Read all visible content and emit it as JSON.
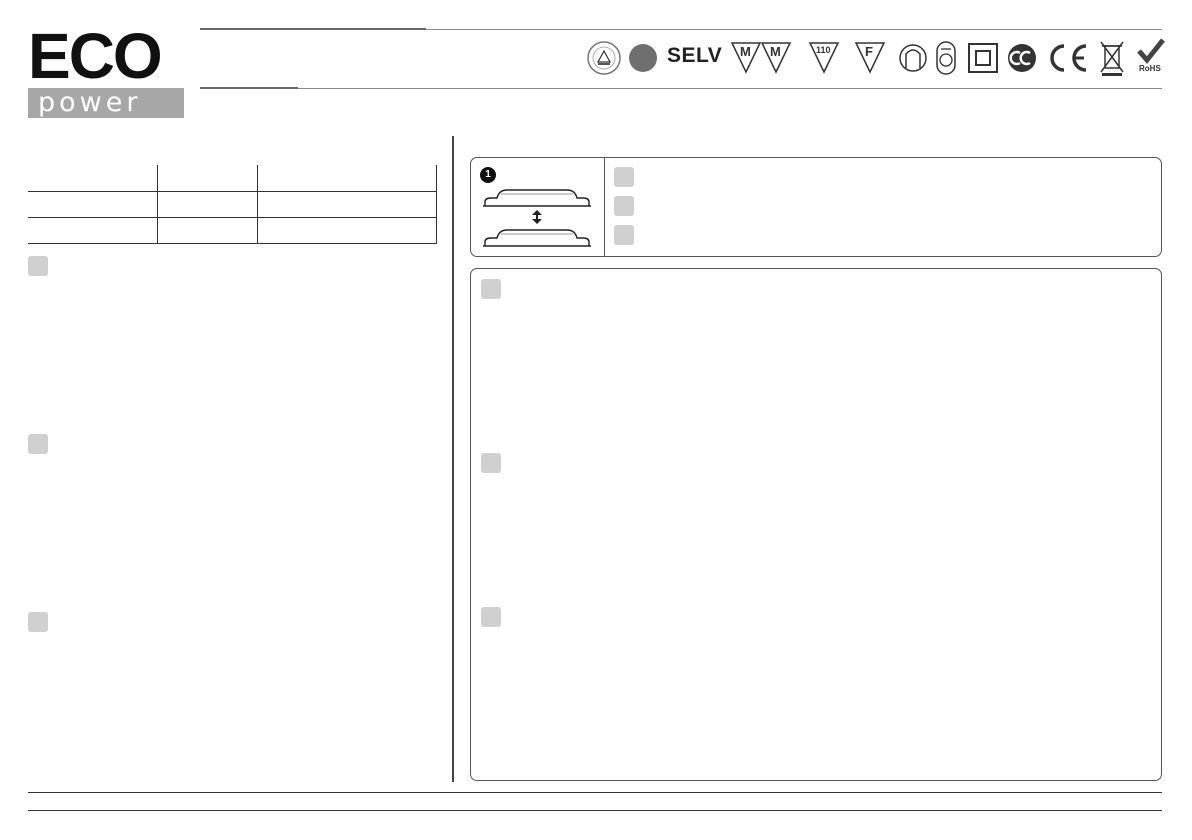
{
  "logo": {
    "line1": "ECO",
    "line2": "power"
  },
  "certifications": {
    "selv_label": "SELV",
    "mm_label": "M",
    "temp_label": "110",
    "f_label": "F",
    "rohs_label": "RoHS",
    "icons": [
      "tuv-safety-mark-icon",
      "filled-circle-icon",
      "selv-icon",
      "mm-furniture-mark-icon",
      "temperature-110-mark-icon",
      "f-mark-icon",
      "lamp-holder-icon",
      "thermal-protection-icon",
      "double-insulation-icon",
      "cc-mark-icon",
      "ce-mark-icon",
      "weee-bin-icon",
      "rohs-check-icon"
    ]
  },
  "left_table": {
    "rows": 3,
    "columns": 3
  },
  "figure": {
    "step_number": "1"
  },
  "colors": {
    "text": "#1a1a1a",
    "rule": "#8a8a8a",
    "marker": "#d0d0d0",
    "logo_band": "#a7a7a7"
  }
}
